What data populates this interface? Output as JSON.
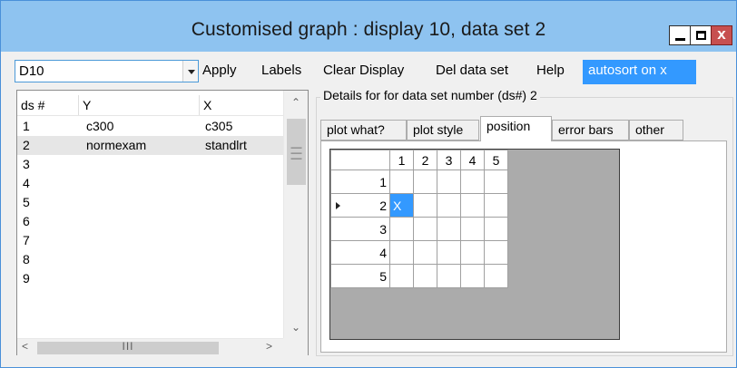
{
  "window": {
    "title": "Customised graph : display 10, data set 2",
    "minimize_label": "minimize",
    "maximize_label": "maximize",
    "close_glyph": "x"
  },
  "toolbar": {
    "combo_value": "D10",
    "apply": "Apply",
    "labels": "Labels",
    "clear_display": "Clear Display",
    "del_data_set": "Del data set",
    "help": "Help",
    "autosort": "autosort on x"
  },
  "datasets": {
    "columns": [
      "ds #",
      "Y",
      "X"
    ],
    "rows": [
      {
        "ds": "1",
        "y": "c300",
        "x": "c305"
      },
      {
        "ds": "2",
        "y": "normexam",
        "x": "standlrt"
      },
      {
        "ds": "3",
        "y": "",
        "x": ""
      },
      {
        "ds": "4",
        "y": "",
        "x": ""
      },
      {
        "ds": "5",
        "y": "",
        "x": ""
      },
      {
        "ds": "6",
        "y": "",
        "x": ""
      },
      {
        "ds": "7",
        "y": "",
        "x": ""
      },
      {
        "ds": "8",
        "y": "",
        "x": ""
      },
      {
        "ds": "9",
        "y": "",
        "x": ""
      }
    ],
    "selected_row": "2"
  },
  "details": {
    "group_label": "Details for for data set number (ds#) 2",
    "tabs": [
      "plot what?",
      "plot style",
      "position",
      "error bars",
      "other"
    ],
    "active_tab": "position",
    "grid": {
      "col_headers": [
        "1",
        "2",
        "3",
        "4",
        "5"
      ],
      "row_headers": [
        "1",
        "2",
        "3",
        "4",
        "5"
      ],
      "current_row": "2",
      "marked_cell": {
        "row": "2",
        "col": "1",
        "value": "X"
      }
    }
  },
  "icons": {
    "scroll_up": "chevron-up-icon",
    "scroll_down": "chevron-down-icon",
    "scroll_left": "chevron-left-icon",
    "scroll_right": "chevron-right-icon"
  },
  "colors": {
    "titlebar": "#8ec3f0",
    "selection": "#3399ff",
    "close_button": "#c75050"
  }
}
